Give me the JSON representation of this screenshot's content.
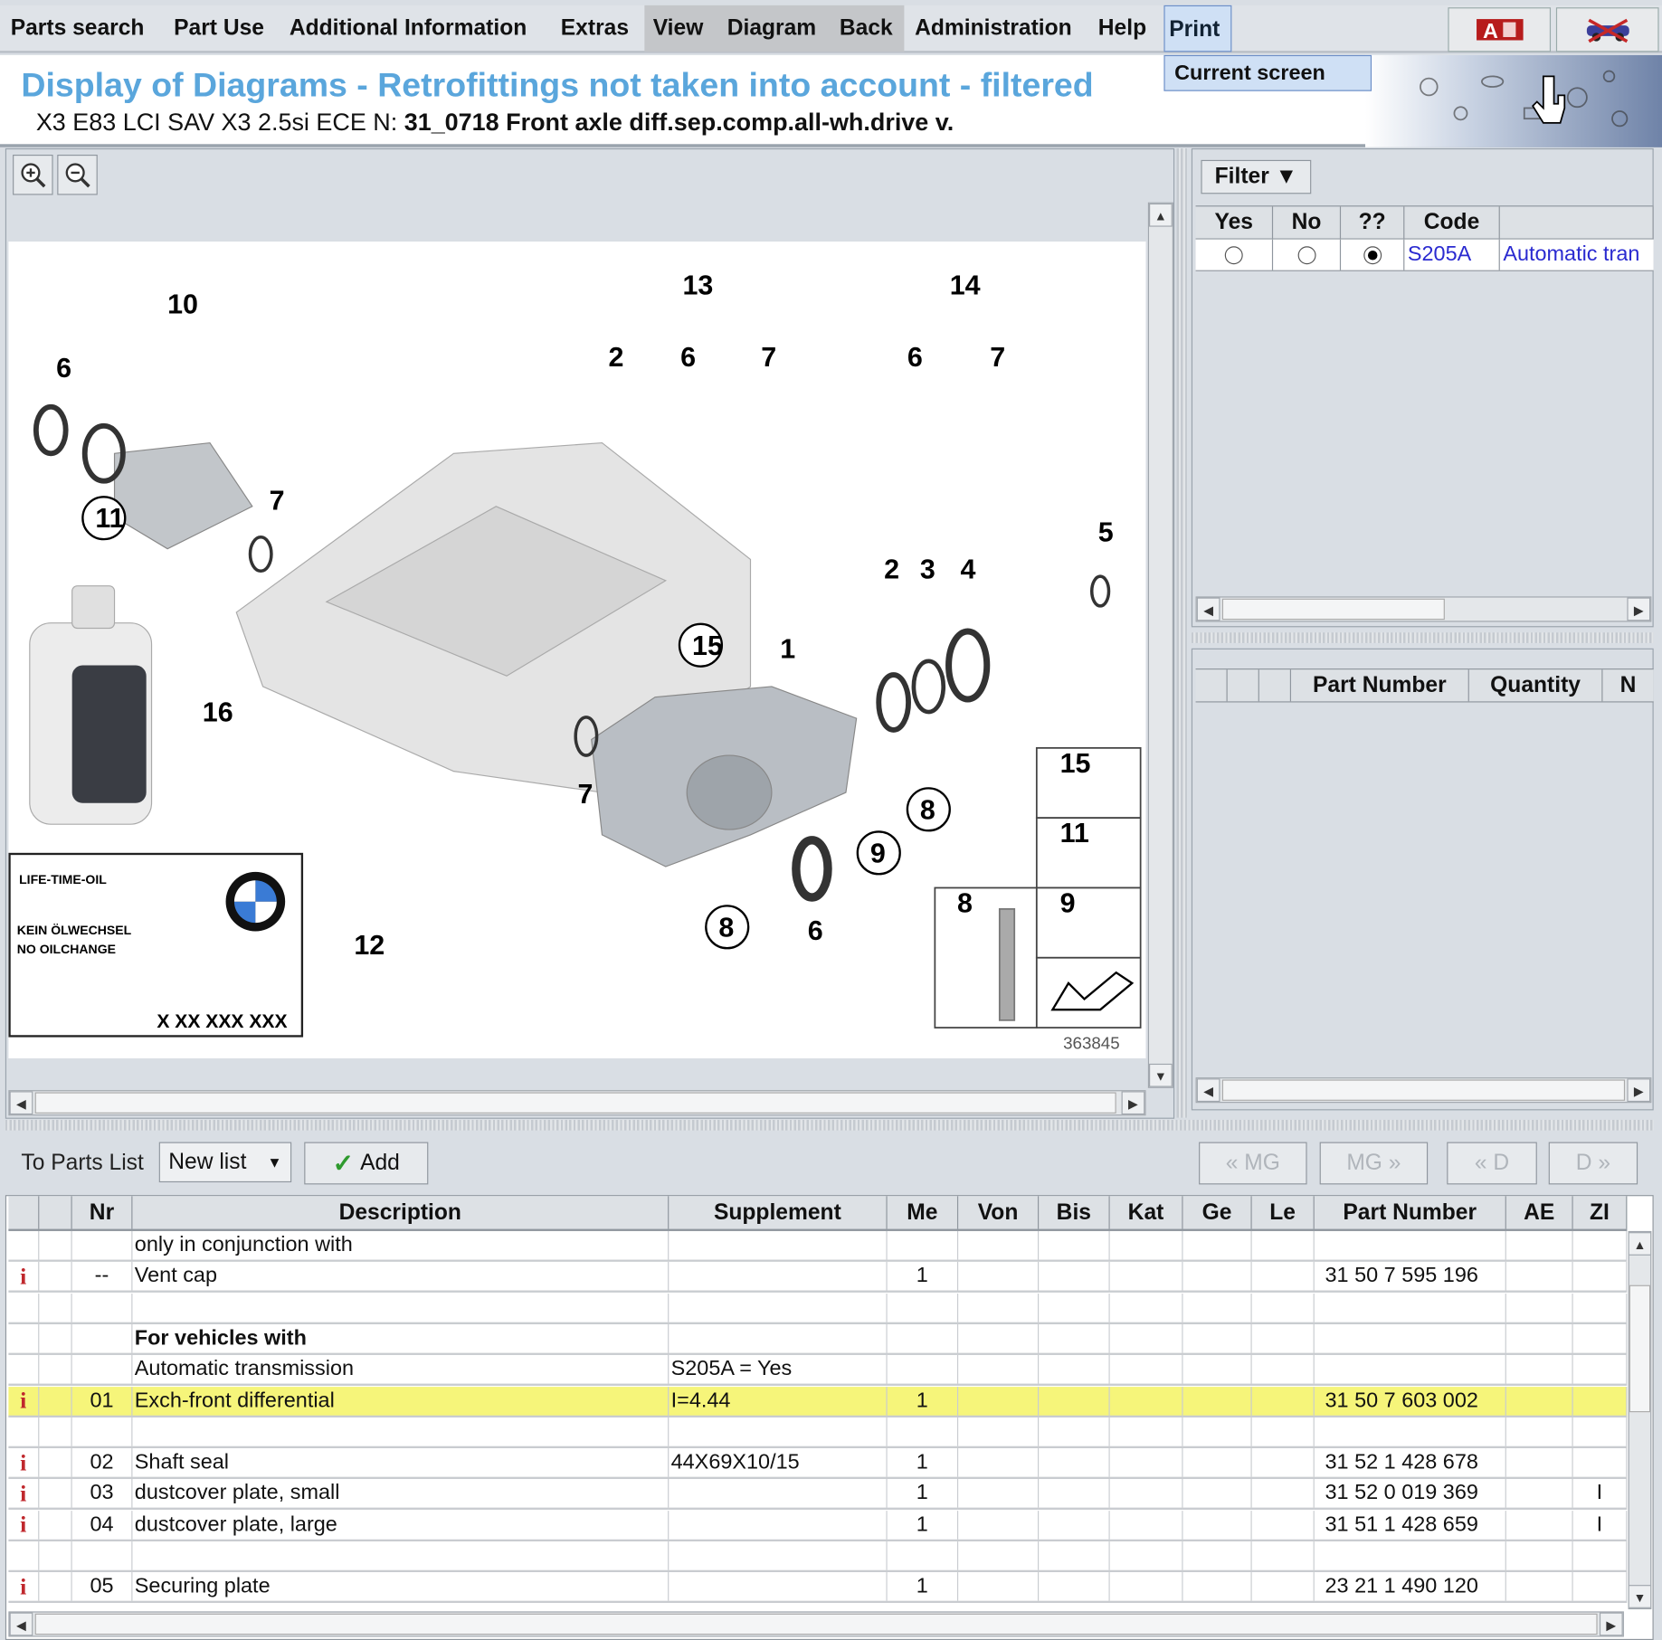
{
  "menu": {
    "items": [
      "Parts search",
      "Part Use",
      "Additional Information",
      "Extras",
      "View",
      "Diagram",
      "Back",
      "Administration",
      "Help",
      "Print"
    ],
    "print_dropdown": [
      "Current screen"
    ],
    "right_icons": [
      "adobe-pdf-icon",
      "vehicle-icon"
    ]
  },
  "header": {
    "title": "Display of Diagrams - Retrofittings not taken into account - filtered",
    "vehicle": "X3 E83 LCI SAV X3 2.5si ECE",
    "n_label": "N:",
    "group": "31_0718 Front axle diff.sep.comp.all-wh.drive v."
  },
  "diagram": {
    "zoom_in_icon": "zoom-in-icon",
    "zoom_out_icon": "zoom-out-icon",
    "callouts": [
      "10",
      "6",
      "11",
      "7",
      "13",
      "2",
      "6",
      "7",
      "14",
      "6",
      "7",
      "16",
      "15",
      "1",
      "2",
      "3",
      "4",
      "5",
      "7",
      "8",
      "9",
      "8",
      "6",
      "12",
      "15",
      "11",
      "8",
      "9"
    ],
    "oil_label": {
      "line1": "LIFE-TIME-OIL",
      "line2": "KEIN ÖLWECHSEL",
      "line3": "NO OILCHANGE",
      "number": "X XX XXX XXX"
    },
    "image_number": "363845"
  },
  "filter": {
    "button": "Filter",
    "columns": [
      "Yes",
      "No",
      "??",
      "Code",
      ""
    ],
    "rows": [
      {
        "selected": "??",
        "code": "S205A",
        "description": "Automatic tran"
      }
    ]
  },
  "parts_panel": {
    "columns": [
      "",
      "",
      "",
      "Part Number",
      "Quantity",
      "N"
    ]
  },
  "toolbar": {
    "to_parts_list": "To Parts List",
    "list_select": "New list",
    "add": "Add",
    "nav": [
      "« MG",
      "MG »",
      "« D",
      "D »"
    ]
  },
  "table": {
    "columns": [
      "",
      "",
      "Nr",
      "Description",
      "Supplement",
      "Me",
      "Von",
      "Bis",
      "Kat",
      "Ge",
      "Le",
      "Part Number",
      "AE",
      "ZI"
    ],
    "rows": [
      {
        "info": false,
        "nr": "",
        "desc": "only in conjunction with",
        "supp": "",
        "me": "",
        "pn": "",
        "zi": ""
      },
      {
        "info": true,
        "nr": "--",
        "desc": "Vent cap",
        "supp": "",
        "me": "1",
        "pn": "31 50 7 595 196",
        "zi": ""
      },
      {
        "info": false,
        "nr": "",
        "desc": "",
        "supp": "",
        "me": "",
        "pn": "",
        "zi": ""
      },
      {
        "info": false,
        "nr": "",
        "desc": "For vehicles with",
        "bold": true,
        "supp": "",
        "me": "",
        "pn": "",
        "zi": ""
      },
      {
        "info": false,
        "nr": "",
        "desc": "Automatic transmission",
        "supp": "S205A = Yes",
        "me": "",
        "pn": "",
        "zi": ""
      },
      {
        "info": true,
        "nr": "01",
        "desc": "Exch-front differential",
        "supp": "I=4.44",
        "me": "1",
        "pn": "31 50 7 603 002",
        "zi": "",
        "highlight": true
      },
      {
        "info": false,
        "nr": "",
        "desc": "",
        "supp": "",
        "me": "",
        "pn": "",
        "zi": ""
      },
      {
        "info": true,
        "nr": "02",
        "desc": "Shaft seal",
        "supp": "44X69X10/15",
        "me": "1",
        "pn": "31 52 1 428 678",
        "zi": ""
      },
      {
        "info": true,
        "nr": "03",
        "desc": "dustcover plate, small",
        "supp": "",
        "me": "1",
        "pn": "31 52 0 019 369",
        "zi": "I",
        "marker": true
      },
      {
        "info": true,
        "nr": "04",
        "desc": "dustcover plate, large",
        "supp": "",
        "me": "1",
        "pn": "31 51 1 428 659",
        "zi": "I",
        "marker": true
      },
      {
        "info": false,
        "nr": "",
        "desc": "",
        "supp": "",
        "me": "",
        "pn": "",
        "zi": ""
      },
      {
        "info": true,
        "nr": "05",
        "desc": "Securing plate",
        "supp": "",
        "me": "1",
        "pn": "23 21 1 490 120",
        "zi": ""
      }
    ]
  },
  "colors": {
    "title": "#5aa6dc",
    "highlight": "#f6f57a",
    "info_icon": "#c0282d",
    "link": "#2a2ad0"
  }
}
